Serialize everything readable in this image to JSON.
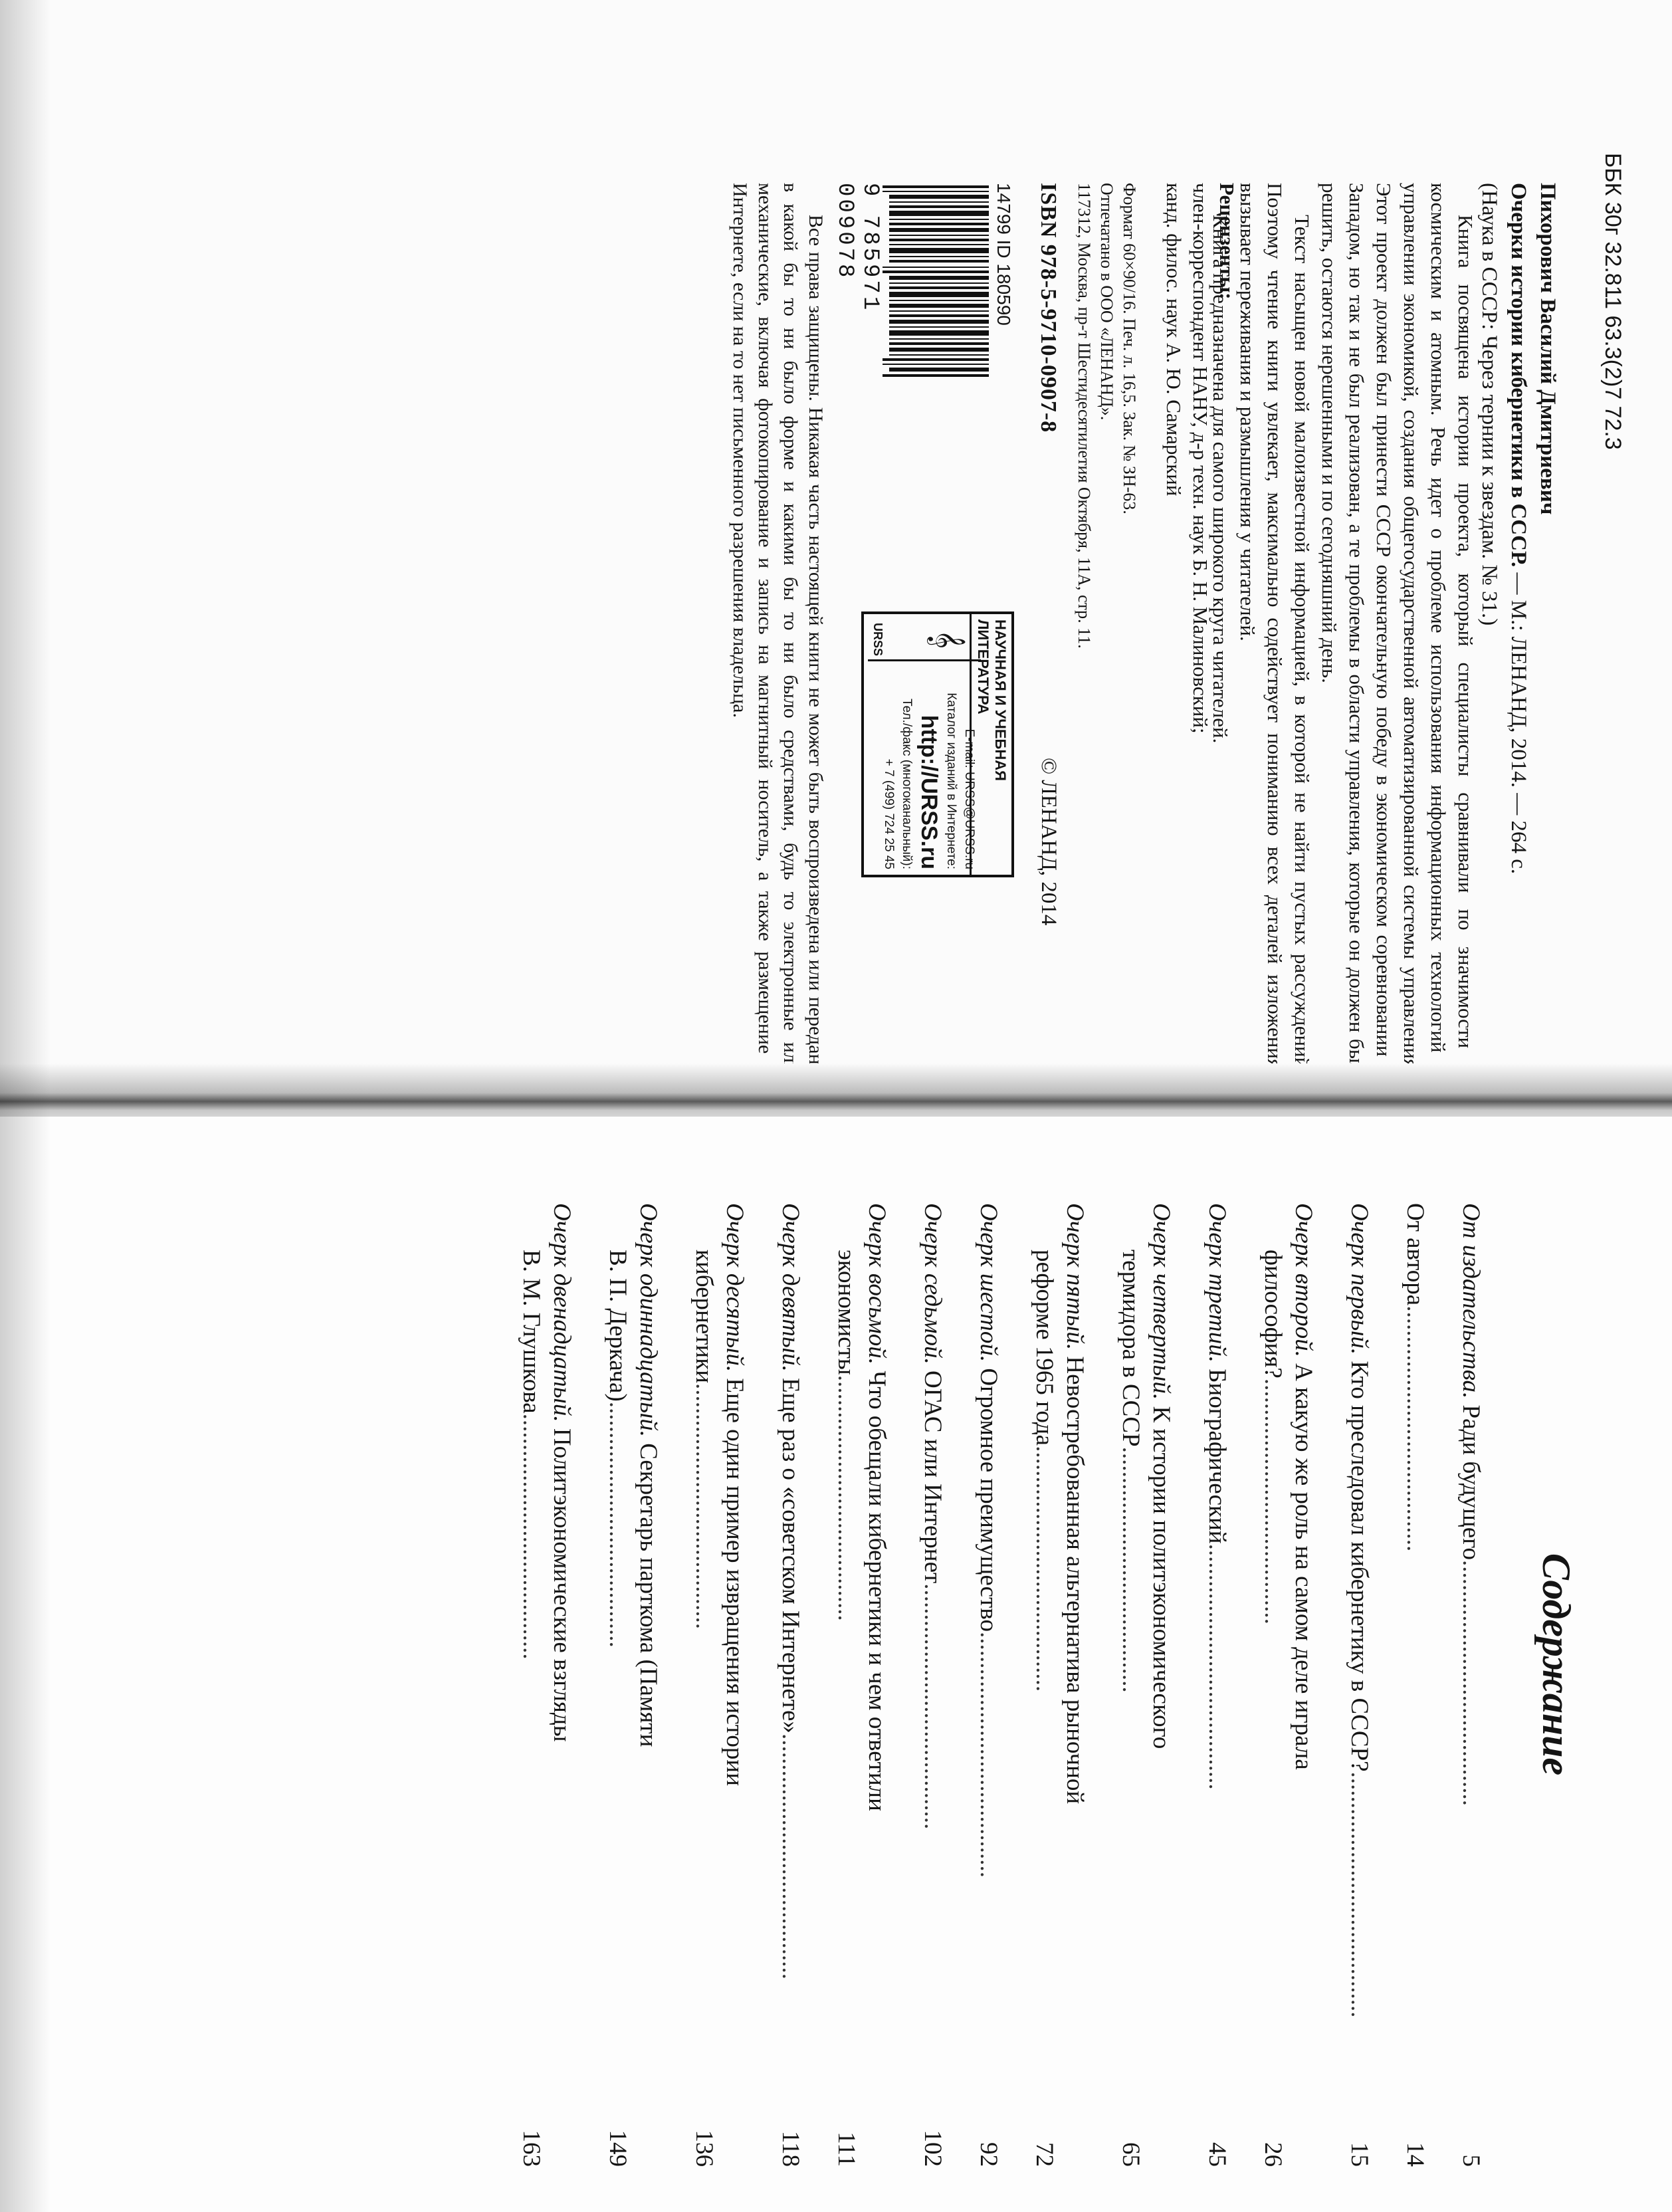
{
  "left_page": {
    "bbk": "ББК 30г 32.811 63.3(2)7 72.3",
    "bib": {
      "author": "Пихорович Василий Дмитриевич",
      "title": "Очерки истории кибернетики в СССР.",
      "imprint": "— М.: ЛЕНАНД, 2014. — 264 с.",
      "series": "(Наука в СССР: Через тернии к звездам. № 31.)"
    },
    "abstract": [
      "Книга посвящена истории проекта, который специалисты сравнивали по значимости с космическим и атомным. Речь идет о проблеме использования информационных технологий в управлении экономикой, создания общегосударственной автоматизированной системы управления. Этот проект должен был принести СССР окончательную победу в экономическом соревновании с Западом, но так и не был реализован, а те проблемы в области управления, которые он должен был решить, остаются нерешенными и по сегодняшний день.",
      "Текст насыщен новой малоизвестной информацией, в которой не найти пустых рассуждений. Поэтому чтение книги увлекает, максимально содействует пониманию всех деталей изложения, вызывает переживания и размышления у читателей.",
      "Книга предназначена для самого широкого круга читателей."
    ],
    "reviewers": {
      "heading": "Рецензенты:",
      "lines": [
        "член-корреспондент НАНУ, д-р техн. наук Б. Н. Малиновский;",
        "канд. филос. наук А. Ю. Самарский"
      ]
    },
    "print_info": [
      "Формат 60×90/16. Печ. л. 16,5. Зак. № ЗН-63.",
      "Отпечатано в ООО «ЛЕНАНД».",
      "117312, Москва, пр-т Шестидесятилетия Октября, 11А, стр. 11."
    ],
    "isbn": "ISBN 978-5-9710-0907-8",
    "copyright": "© ЛЕНАНД, 2014",
    "barcode": {
      "id": "14799 ID 180590",
      "digits": "9 785971 009078"
    },
    "urss": {
      "header": "НАУЧНАЯ И УЧЕБНАЯ ЛИТЕРАТУРА",
      "email": "E-mail: URSS@URSS.ru",
      "catalog": "Каталог изданий в Интернете:",
      "url": "http://URSS.ru",
      "phone_label": "Тел./факс (многоканальный):",
      "phone": "+ 7 (499) 724 25 45",
      "brand": "URSS"
    },
    "rights": "Все права защищены. Никакая часть настоящей книги не может быть воспроизведена или передана в какой бы то ни было форме и какими бы то ни было средствами, будь то электронные или механические, включая фотокопирование и запись на магнитный носитель, а также размещение в Интернете, если на то нет письменного разрешения владельца."
  },
  "right_page": {
    "title": "Содержание",
    "toc": [
      {
        "lead": "От издательства.",
        "text": " Ради будущего",
        "cont": "",
        "page": "5"
      },
      {
        "lead": "",
        "text": "От автора",
        "cont": "",
        "page": "14"
      },
      {
        "lead": "Очерк первый.",
        "text": " Кто преследовал кибернетику в СССР?",
        "cont": "",
        "page": "15"
      },
      {
        "lead": "Очерк второй.",
        "text": " А какую же роль на самом деле играла",
        "cont": "философия?",
        "page": "26"
      },
      {
        "lead": "Очерк третий.",
        "text": " Биографический",
        "cont": "",
        "page": "45"
      },
      {
        "lead": "Очерк четвертый.",
        "text": " К истории политэкономического",
        "cont": "термидора в СССР",
        "page": "65"
      },
      {
        "lead": "Очерк пятый.",
        "text": " Невостребованная альтернатива рыночной",
        "cont": "реформе 1965 года",
        "page": "72"
      },
      {
        "lead": "Очерк шестой.",
        "text": " Огромное преимущество",
        "cont": "",
        "page": "92"
      },
      {
        "lead": "Очерк седьмой.",
        "text": " ОГАС или Интернет",
        "cont": "",
        "page": "102"
      },
      {
        "lead": "Очерк восьмой.",
        "text": " Что обещали кибернетики и чем ответили",
        "cont": "экономисты",
        "page": "111"
      },
      {
        "lead": "Очерк девятый.",
        "text": " Еще раз о «советском Интернете»",
        "cont": "",
        "page": "118"
      },
      {
        "lead": "Очерк десятый.",
        "text": " Еще один пример извращения истории",
        "cont": "кибернетики",
        "page": "136"
      },
      {
        "lead": "Очерк одиннадцатый.",
        "text": " Секретарь парткома (Памяти",
        "cont": "В. П. Деркача)",
        "page": "149"
      },
      {
        "lead": "Очерк двенадцатый.",
        "text": " Политэкономические взгляды",
        "cont": "В. М. Глушкова",
        "page": "163"
      }
    ]
  }
}
